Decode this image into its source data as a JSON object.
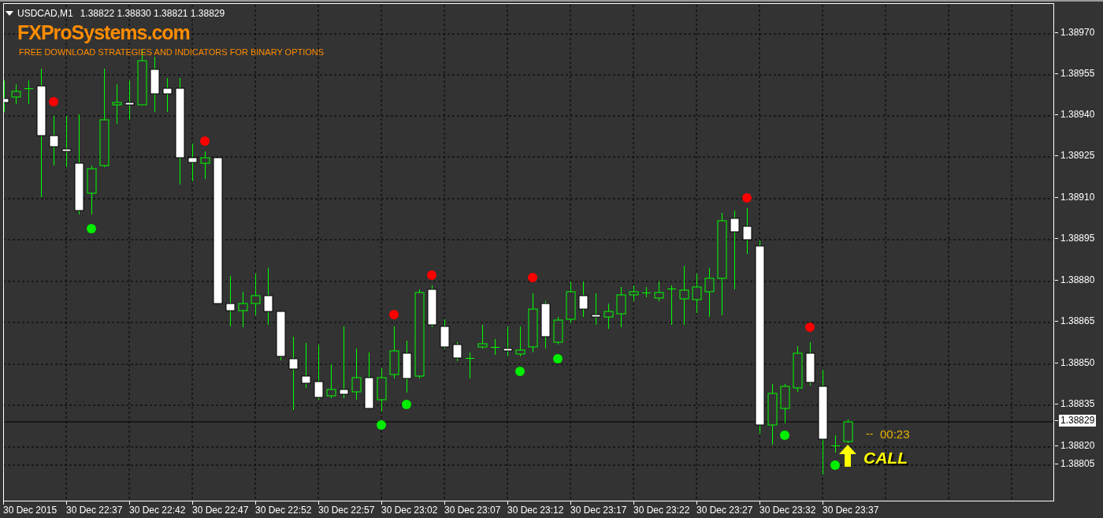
{
  "header": {
    "symbol": "USDCAD,M1",
    "ohlc": "1.38822 1.38830 1.38821 1.38829"
  },
  "overlay": {
    "brand": "FXProSystems.com",
    "tagline": "FREE DOWNLOAD STRATEGIES AND INDICATORS FOR BINARY OPTIONS"
  },
  "timer": {
    "dashes": "--",
    "time": "00:23"
  },
  "signal": {
    "label": "CALL"
  },
  "price_axis": [
    {
      "text": "1.38970",
      "highlighted": false
    },
    {
      "text": "1.38955",
      "highlighted": false
    },
    {
      "text": "1.38940",
      "highlighted": false
    },
    {
      "text": "1.38925",
      "highlighted": false
    },
    {
      "text": "1.38910",
      "highlighted": false
    },
    {
      "text": "1.38895",
      "highlighted": false
    },
    {
      "text": "1.38880",
      "highlighted": false
    },
    {
      "text": "1.38865",
      "highlighted": false
    },
    {
      "text": "1.38850",
      "highlighted": false
    },
    {
      "text": "1.38835",
      "highlighted": false
    },
    {
      "text": "1.38829",
      "highlighted": true
    },
    {
      "text": "1.38820",
      "highlighted": false
    },
    {
      "text": "1.38805",
      "highlighted": false
    }
  ],
  "time_axis": [
    "30 Dec 2015",
    "30 Dec 22:37",
    "30 Dec 22:42",
    "30 Dec 22:47",
    "30 Dec 22:52",
    "30 Dec 22:57",
    "30 Dec 23:02",
    "30 Dec 23:07",
    "30 Dec 23:12",
    "30 Dec 23:17",
    "30 Dec 23:22",
    "30 Dec 23:27",
    "30 Dec 23:32",
    "30 Dec 23:37"
  ]
}
